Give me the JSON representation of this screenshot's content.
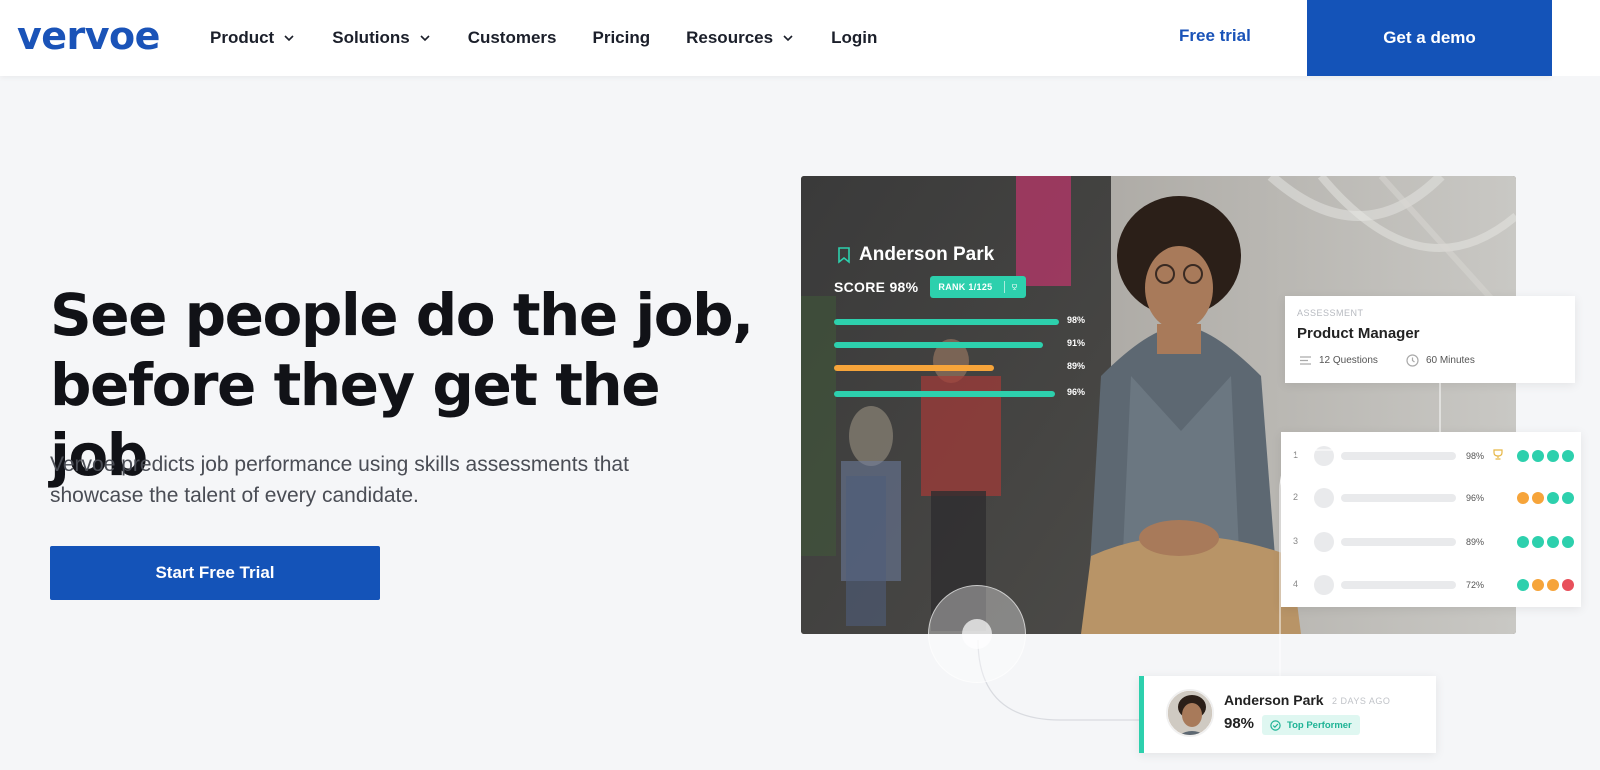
{
  "header": {
    "logo": "vervoe",
    "nav": [
      {
        "label": "Product",
        "dropdown": true
      },
      {
        "label": "Solutions",
        "dropdown": true
      },
      {
        "label": "Customers",
        "dropdown": false
      },
      {
        "label": "Pricing",
        "dropdown": false
      },
      {
        "label": "Resources",
        "dropdown": true
      },
      {
        "label": "Login",
        "dropdown": false
      }
    ],
    "free_trial": "Free trial",
    "get_demo": "Get a demo"
  },
  "hero": {
    "title_line1": "See people do the job,",
    "title_line2": "before they get the job",
    "subtitle": "Vervoe predicts job performance using skills assessments that showcase the talent of every candidate.",
    "cta": "Start Free Trial"
  },
  "overlay": {
    "candidate_name": "Anderson Park",
    "score": "SCORE 98%",
    "rank": "RANK 1/125",
    "bars": [
      {
        "pct": "98%",
        "value": 0.98,
        "color": "#2dd0ad"
      },
      {
        "pct": "91%",
        "value": 0.91,
        "color": "#2dd0ad"
      },
      {
        "pct": "89%",
        "value": 0.89,
        "color": "#f6a43a"
      },
      {
        "pct": "96%",
        "value": 0.96,
        "color": "#2dd0ad"
      }
    ]
  },
  "assessment_card": {
    "label": "ASSESSMENT",
    "title": "Product Manager",
    "questions": "12 Questions",
    "minutes": "60 Minutes"
  },
  "ranking_card": {
    "rows": [
      {
        "num": "1",
        "pct": "98%",
        "trophy": true,
        "dots": [
          "#2dd0ad",
          "#2dd0ad",
          "#2dd0ad",
          "#2dd0ad"
        ]
      },
      {
        "num": "2",
        "pct": "96%",
        "trophy": false,
        "dots": [
          "#f6a43a",
          "#f6a43a",
          "#2dd0ad",
          "#2dd0ad"
        ]
      },
      {
        "num": "3",
        "pct": "89%",
        "trophy": false,
        "dots": [
          "#2dd0ad",
          "#2dd0ad",
          "#2dd0ad",
          "#2dd0ad"
        ]
      },
      {
        "num": "4",
        "pct": "72%",
        "trophy": false,
        "dots": [
          "#2dd0ad",
          "#f6a43a",
          "#f6a43a",
          "#e8505b"
        ]
      }
    ]
  },
  "performer_card": {
    "name": "Anderson Park",
    "time_ago": "2 DAYS AGO",
    "pct": "98%",
    "badge": "Top Performer"
  },
  "colors": {
    "brand": "#1453b8",
    "accent_teal": "#2dd0ad",
    "accent_orange": "#f6a43a",
    "accent_red": "#e8505b",
    "background": "#f5f6f8"
  }
}
